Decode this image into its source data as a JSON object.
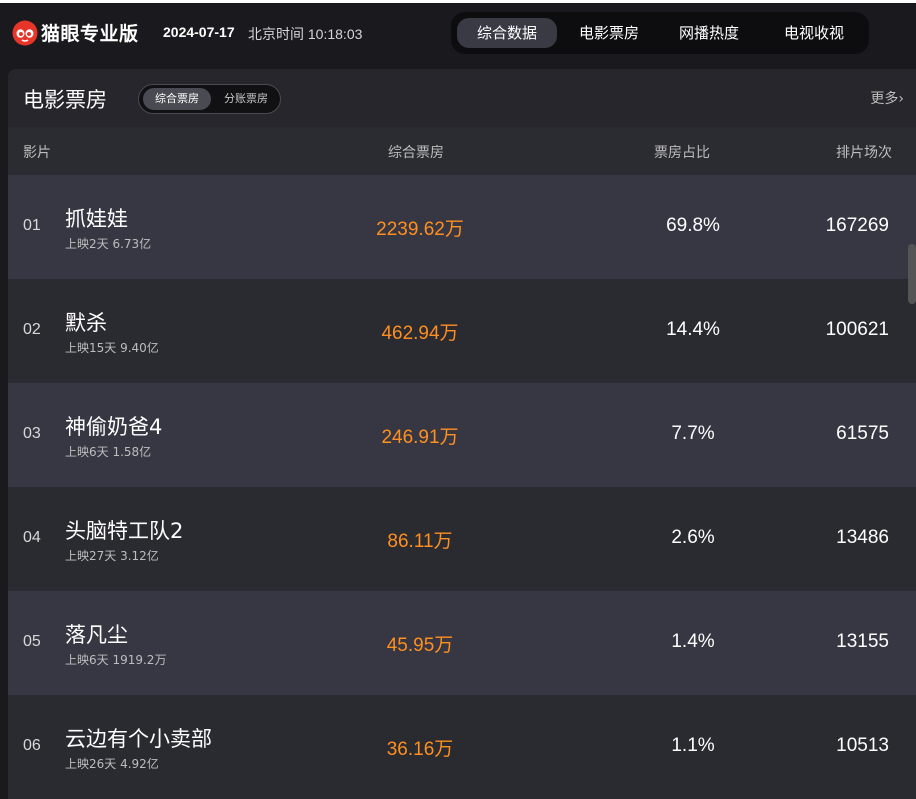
{
  "header": {
    "brand": "猫眼专业版",
    "date": "2024-07-17",
    "time_label": "北京时间 10:18:03",
    "nav": [
      {
        "label": "综合数据",
        "active": true
      },
      {
        "label": "电影票房",
        "active": false
      },
      {
        "label": "网播热度",
        "active": false
      },
      {
        "label": "电视收视",
        "active": false
      }
    ]
  },
  "panel": {
    "title": "电影票房",
    "toggle": [
      {
        "label": "综合票房",
        "active": true
      },
      {
        "label": "分账票房",
        "active": false
      }
    ],
    "more": "更多",
    "columns": {
      "film": "影片",
      "box": "综合票房",
      "share": "票房占比",
      "shows": "排片场次"
    },
    "rows": [
      {
        "rank": "01",
        "name": "抓娃娃",
        "meta": "上映2天  6.73亿",
        "box": "2239.62万",
        "share": "69.8%",
        "shows": "167269"
      },
      {
        "rank": "02",
        "name": "默杀",
        "meta": "上映15天  9.40亿",
        "box": "462.94万",
        "share": "14.4%",
        "shows": "100621"
      },
      {
        "rank": "03",
        "name": "神偷奶爸4",
        "meta": "上映6天  1.58亿",
        "box": "246.91万",
        "share": "7.7%",
        "shows": "61575"
      },
      {
        "rank": "04",
        "name": "头脑特工队2",
        "meta": "上映27天  3.12亿",
        "box": "86.11万",
        "share": "2.6%",
        "shows": "13486"
      },
      {
        "rank": "05",
        "name": "落凡尘",
        "meta": "上映6天  1919.2万",
        "box": "45.95万",
        "share": "1.4%",
        "shows": "13155"
      },
      {
        "rank": "06",
        "name": "云边有个小卖部",
        "meta": "上映26天  4.92亿",
        "box": "36.16万",
        "share": "1.1%",
        "shows": "10513"
      }
    ]
  },
  "colors": {
    "accent_orange": "#ff8f1f",
    "logo_red": "#e8352a",
    "row_light": "#373743",
    "row_dark": "#2a2a31"
  }
}
